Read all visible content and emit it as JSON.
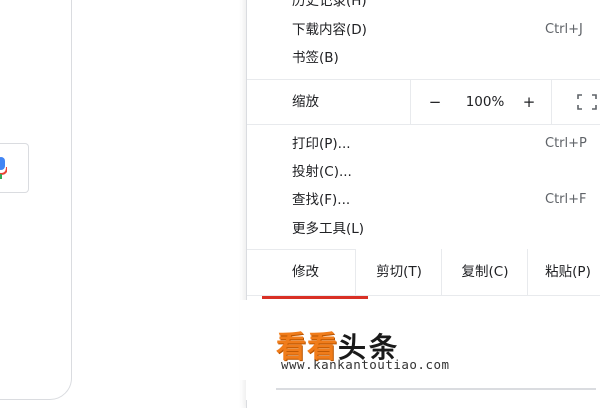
{
  "menu": {
    "history_label": "历史记录(H)",
    "downloads_label": "下载内容(D)",
    "downloads_shortcut": "Ctrl+J",
    "bookmarks_label": "书签(B)",
    "zoom": {
      "label": "缩放",
      "minus": "−",
      "value": "100%",
      "plus": "+"
    },
    "print_label": "打印(P)...",
    "print_shortcut": "Ctrl+P",
    "cast_label": "投射(C)...",
    "find_label": "查找(F)...",
    "find_shortcut": "Ctrl+F",
    "more_tools_label": "更多工具(L)",
    "edit": {
      "label": "修改",
      "cut": "剪切(T)",
      "copy": "复制(C)",
      "paste": "粘贴(P)"
    }
  },
  "watermark": {
    "logo_orange": "看看",
    "logo_black": "头条",
    "url": "www.kankantoutiao.com"
  },
  "icons": {
    "mic": "microphone-icon",
    "fullscreen": "fullscreen-icon"
  }
}
